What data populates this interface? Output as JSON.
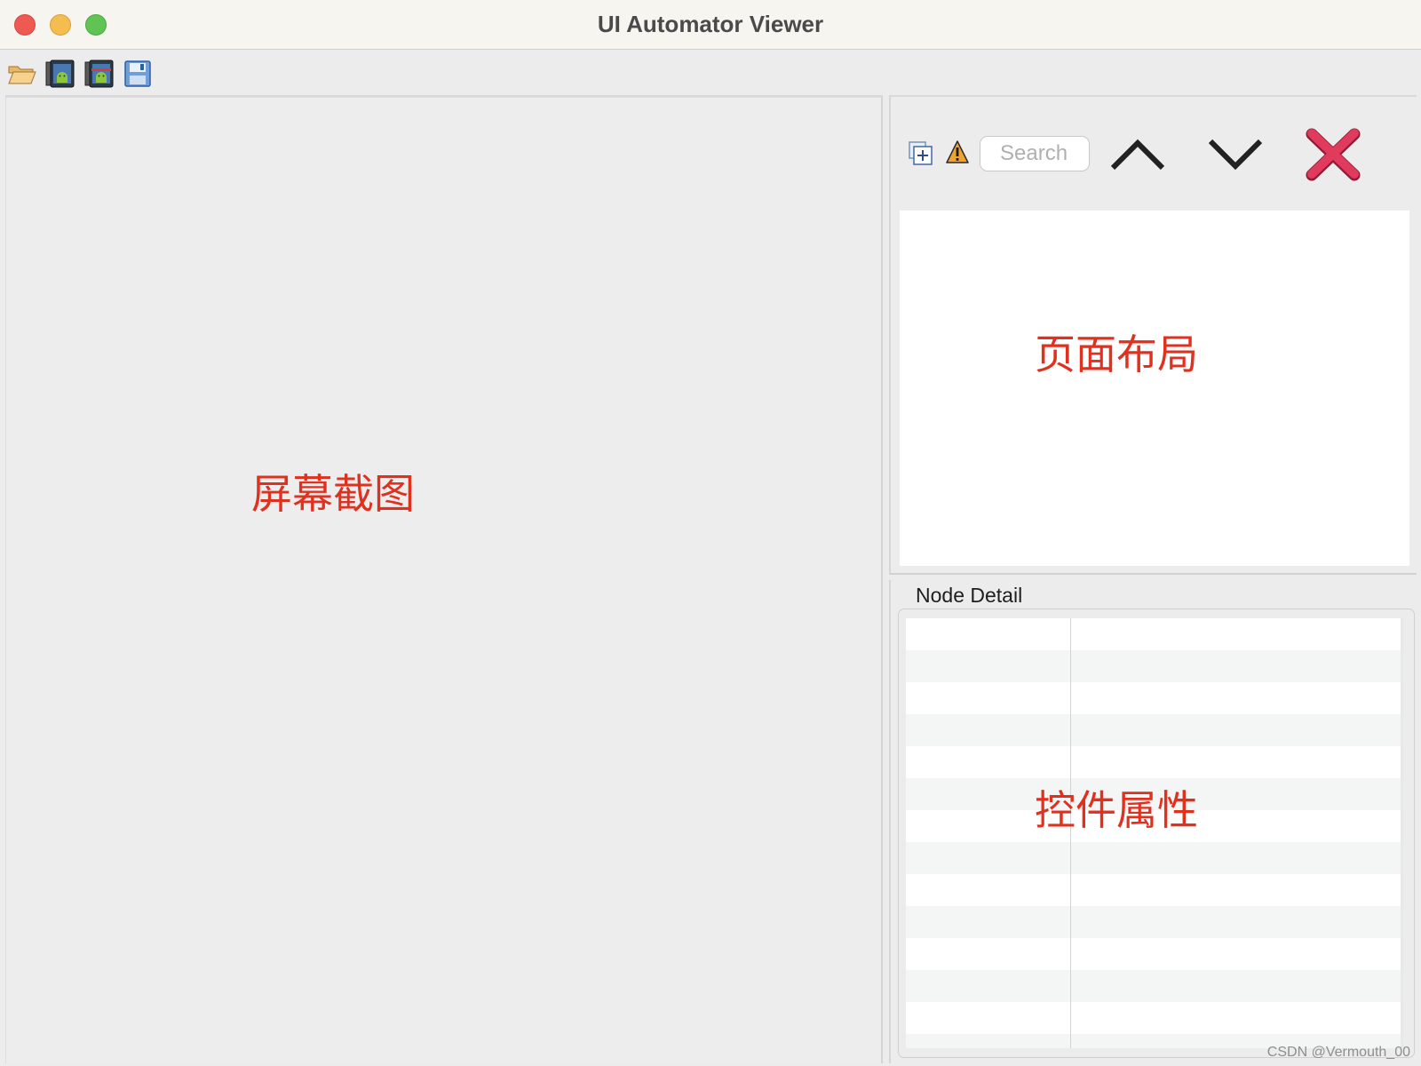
{
  "window": {
    "title": "UI Automator Viewer"
  },
  "toolbar": {
    "items": [
      {
        "icon": "open-folder-icon"
      },
      {
        "icon": "device-screenshot-icon"
      },
      {
        "icon": "device-screenshot-compressed-icon"
      },
      {
        "icon": "save-icon"
      }
    ]
  },
  "screenshot_panel": {
    "overlay_label": "屏幕截图"
  },
  "hierarchy_panel": {
    "expand_icon": "expand-all-icon",
    "warning_icon": "warning-icon",
    "search_placeholder": "Search",
    "search_value": "",
    "prev_icon": "chevron-up-icon",
    "next_icon": "chevron-down-icon",
    "clear_icon": "close-icon",
    "overlay_label": "页面布局"
  },
  "node_detail": {
    "title": "Node Detail",
    "overlay_label": "控件属性"
  },
  "watermark": "CSDN @Vermouth_00",
  "colors": {
    "overlay_text": "#e0311f",
    "close_button": "#e03a5c",
    "traffic_close": "#ee5a52",
    "traffic_minimize": "#f5bd4f",
    "traffic_maximize": "#5fc454"
  }
}
